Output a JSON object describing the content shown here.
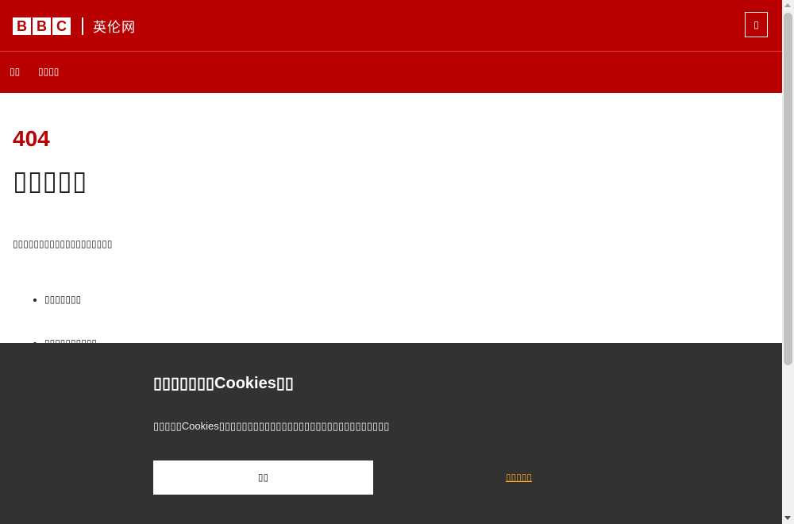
{
  "header": {
    "logo_letters": [
      "B",
      "B",
      "C"
    ],
    "site_name": "英伦网",
    "menu_button_label": "",
    "menu_icon": "menu-icon"
  },
  "nav": {
    "items": [
      {
        "label": ""
      },
      {
        "label": ""
      }
    ]
  },
  "main": {
    "error_code": "404",
    "error_title": "",
    "error_description": "",
    "links": [
      {
        "label": ""
      },
      {
        "label": ""
      }
    ]
  },
  "cookie_banner": {
    "title": "Cookies",
    "text": "Cookies",
    "accept_label": "",
    "settings_label": "",
    "background_color": "#323232",
    "link_color": "#fca311"
  },
  "colors": {
    "brand_red": "#b80000"
  }
}
